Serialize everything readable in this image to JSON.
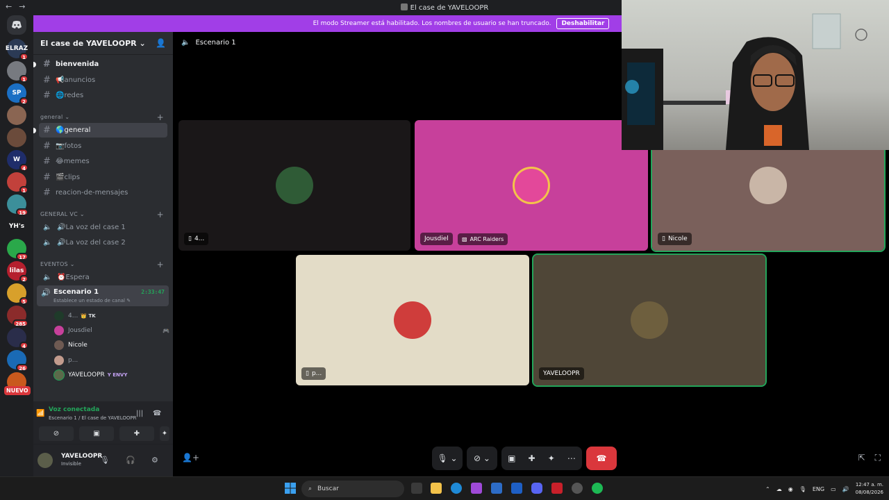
{
  "window": {
    "title": "El case de YAVELOOPR",
    "back": "←",
    "forward": "→"
  },
  "streamer_banner": {
    "text": "El modo Streamer está habilitado. Los nombres de usuario se han truncado.",
    "button": "Deshabilitar"
  },
  "guilds": [
    {
      "label": "ELRAZ",
      "color": "#2b3a55",
      "badge": "1"
    },
    {
      "label": "",
      "color": "#777a80",
      "badge": "1"
    },
    {
      "label": "SP",
      "color": "#1b6fc4",
      "badge": "2"
    },
    {
      "label": "",
      "color": "#8a6552",
      "badge": ""
    },
    {
      "label": "",
      "color": "#6b4b3b",
      "badge": ""
    },
    {
      "label": "W",
      "color": "#1f2d6a",
      "badge": "4"
    },
    {
      "label": "",
      "color": "#c2413b",
      "badge": "1"
    },
    {
      "label": "",
      "color": "#3c8f9a",
      "badge": "19"
    },
    {
      "label": "YH's",
      "color": "#1e1f22",
      "badge": ""
    },
    {
      "label": "",
      "color": "#2aa84a",
      "badge": "17"
    },
    {
      "label": "lilas",
      "color": "#b51f2e",
      "badge": "2"
    },
    {
      "label": "",
      "color": "#d8a02b",
      "badge": "5"
    },
    {
      "label": "",
      "color": "#8b2b2b",
      "badge": "285"
    },
    {
      "label": "",
      "color": "#2a2d4a",
      "badge": "4"
    },
    {
      "label": "",
      "color": "#1a6ab5",
      "badge": "26"
    },
    {
      "label": "",
      "color": "#c9591d",
      "badge": ""
    }
  ],
  "guild_new": "NUEVO",
  "server": {
    "name": "El case de YAVELOOPR",
    "chevron": "⌄"
  },
  "channels_top": [
    {
      "label": "bienvenida",
      "emoji": "",
      "unread": true
    },
    {
      "label": "anuncios",
      "emoji": "📢",
      "unread": false
    },
    {
      "label": "redes",
      "emoji": "🌐",
      "unread": false
    }
  ],
  "category_general": "general",
  "channels_general": [
    {
      "label": "general",
      "emoji": "🌎",
      "active": true
    },
    {
      "label": "fotos",
      "emoji": "📷",
      "active": false
    },
    {
      "label": "memes",
      "emoji": "😂",
      "active": false
    },
    {
      "label": "clips",
      "emoji": "🎬",
      "active": false
    },
    {
      "label": "reacion-de-mensajes",
      "emoji": "",
      "active": false
    }
  ],
  "category_vc": "GENERAL VC",
  "voice_channels": [
    {
      "label": "La voz del case 1",
      "emoji": "🔊"
    },
    {
      "label": "La voz del case 2",
      "emoji": "🔊"
    }
  ],
  "category_events": "EVENTOS",
  "event_channel": {
    "label": "Espera",
    "emoji": "⏰"
  },
  "stage": {
    "name": "Escenario 1",
    "status": "Establece un estado de canal ✎",
    "time": "2:33:47"
  },
  "stage_users": [
    {
      "name": "4...",
      "tag": "👑 TK",
      "color": "#1f3b2a"
    },
    {
      "name": "Jousdiel",
      "tag": "",
      "color": "#c7409b"
    },
    {
      "name": "Nicole",
      "tag": "",
      "color": "#6e5a52"
    },
    {
      "name": "p...",
      "tag": "",
      "color": "#c29b8d"
    },
    {
      "name": "YAVELOOPR",
      "tag": "Y ENVY",
      "color": "#5b6a4a"
    }
  ],
  "voice_panel": {
    "title": "Voz conectada",
    "subtitle": "Escenario 1 / El case de YAVELOOPR"
  },
  "user_panel": {
    "name": "YAVELOOPR",
    "status": "Invisible"
  },
  "stage_header": "Escenario 1",
  "tiles": [
    {
      "label": "4...",
      "bg": "#1a1718",
      "avatar": "#2f5b36",
      "icon": "📱"
    },
    {
      "label": "Jousdiel",
      "bg": "#c7409b",
      "avatar": "#e3489a",
      "game": "ARC Raiders"
    },
    {
      "label": "Nicole",
      "bg": "#7a605b",
      "avatar": "#c9b6a7",
      "icon": "📱"
    },
    {
      "label": "p...",
      "bg": "#e3dcc7",
      "avatar": "#cf3d3b",
      "icon": "📱"
    },
    {
      "label": "YAVELOOPR",
      "bg": "#4f4637",
      "avatar": "#6e5f3e"
    }
  ],
  "taskbar": {
    "search": "Buscar",
    "lang": "ENG",
    "time": "12:47 a. m.",
    "date": "08/08/2026"
  }
}
